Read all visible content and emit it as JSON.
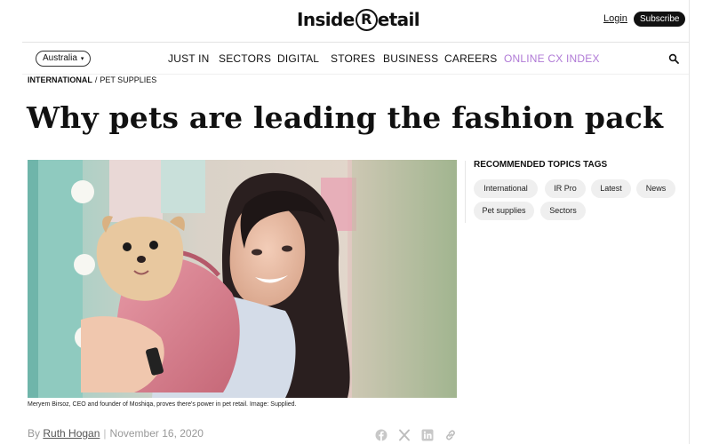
{
  "header": {
    "logo_left": "Inside",
    "logo_r": "R",
    "logo_right": "etail",
    "login": "Login",
    "subscribe": "Subscribe"
  },
  "nav": {
    "region": "Australia",
    "items": [
      "JUST IN",
      "SECTORS",
      "DIGITAL",
      "STORES",
      "BUSINESS",
      "CAREERS",
      "ONLINE CX INDEX"
    ],
    "accent_color": "#b07ad6"
  },
  "breadcrumb": [
    "INTERNATIONAL",
    "/",
    "PET SUPPLIES"
  ],
  "article": {
    "title": "Why pets are leading the fashion pack",
    "caption": "Meryem Birsoz, CEO and founder of Moshiqa, proves there's power in pet retail. Image: Supplied.",
    "by": "By",
    "author": "Ruth Hogan",
    "divider": "|",
    "date": "November 16, 2020"
  },
  "sidebar": {
    "title": "RECOMMENDED TOPICS TAGS",
    "tags": [
      "International",
      "IR Pro",
      "Latest",
      "News",
      "Pet supplies",
      "Sectors"
    ]
  },
  "share_icons": [
    "facebook-icon",
    "x-icon",
    "linkedin-icon",
    "link-icon"
  ]
}
